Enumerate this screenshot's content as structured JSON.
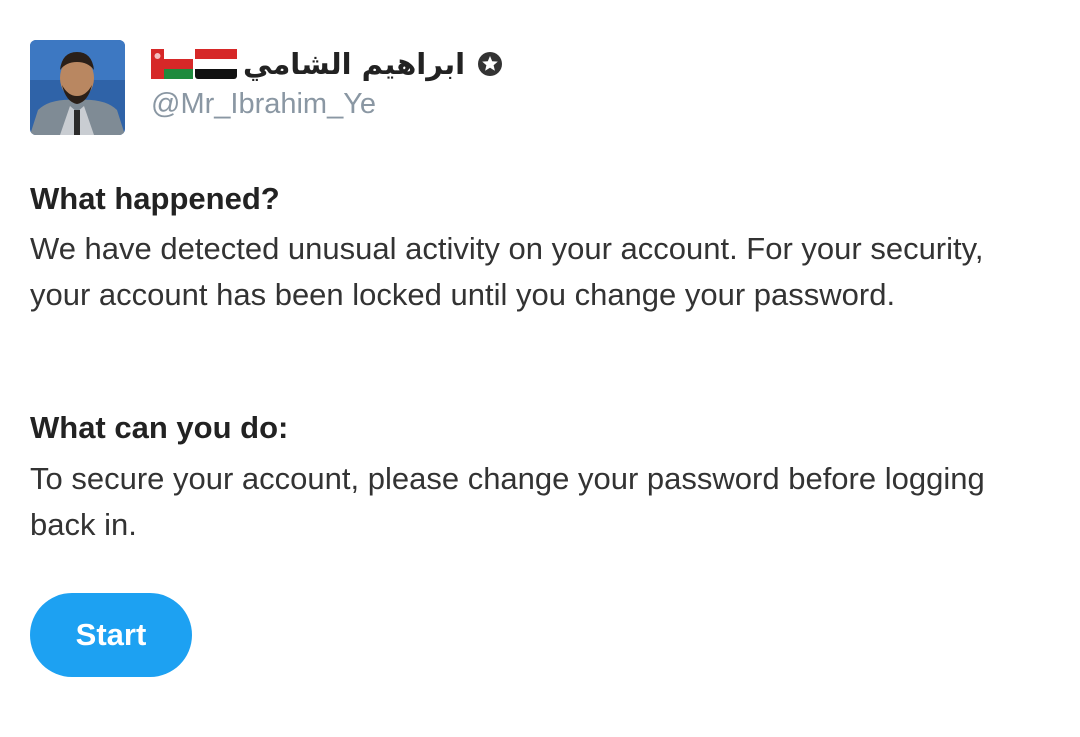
{
  "profile": {
    "display_name": "ابراهيم الشامي",
    "handle": "@Mr_Ibrahim_Ye",
    "flags": [
      "oman-flag",
      "yemen-flag"
    ],
    "badge_icon": "star-badge-icon"
  },
  "sections": [
    {
      "title": "What happened?",
      "body": "We have detected unusual activity on your account. For your security, your account has been locked until you change your password."
    },
    {
      "title": "What can you do:",
      "body": "To secure your account, please change your password before logging back in."
    }
  ],
  "actions": {
    "start_label": "Start"
  },
  "colors": {
    "accent": "#1da1f2",
    "handle": "#8a97a3",
    "text": "#333333"
  }
}
